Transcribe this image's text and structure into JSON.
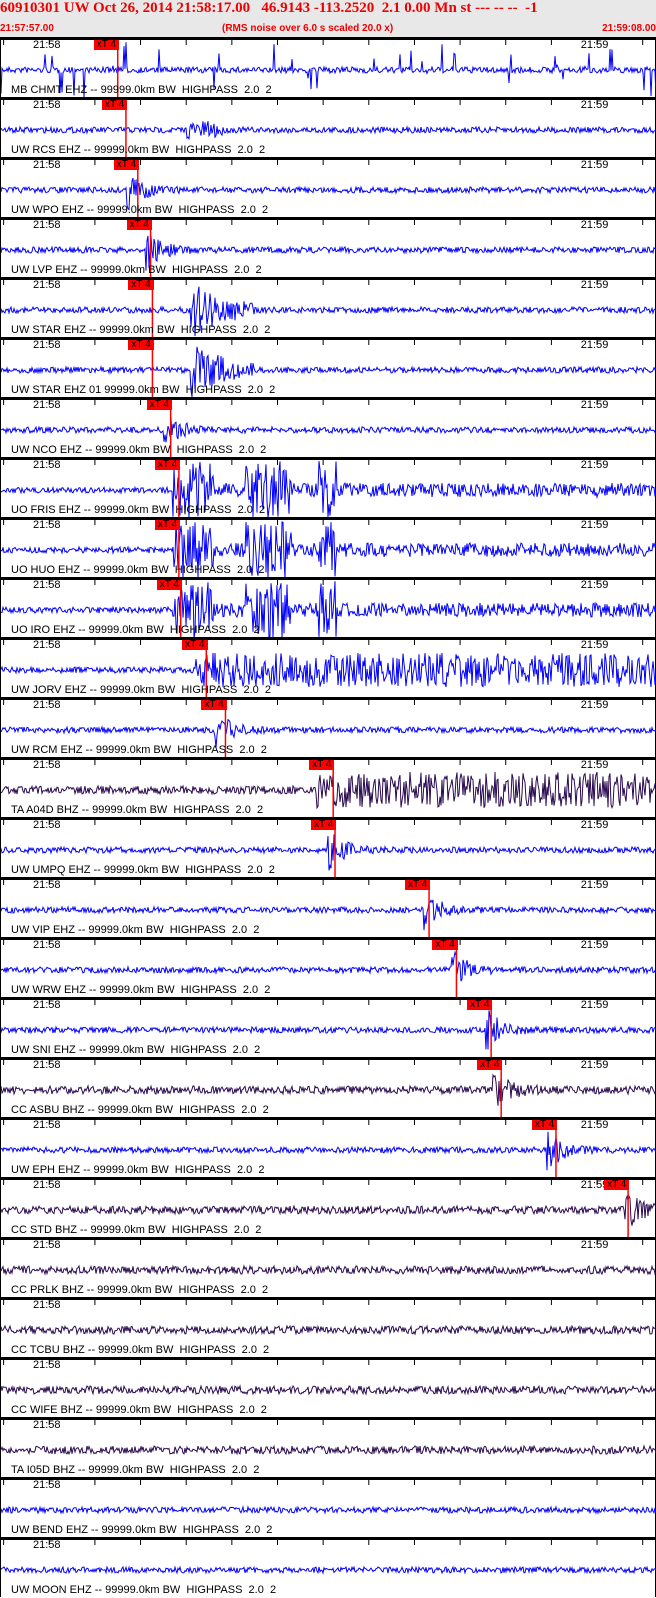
{
  "header": {
    "title": "60910301 UW Oct 26, 2014 21:58:17.00   46.9143 -113.2520  2.1 0.00 Mn st --- -- --  -1",
    "start_time": "21:57:57.00",
    "note": "(RMS noise over 6.0 s scaled 20.0 x)",
    "end_time": "21:59:08.00"
  },
  "chart_data": {
    "type": "line",
    "title": "60910301 UW Oct 26, 2014 21:58:17.00",
    "x_range_seconds": [
      0,
      71
    ],
    "x_start": "21:57:57.00",
    "x_end": "21:59:08.00",
    "tick_labels": [
      "21:58",
      "21:59"
    ],
    "tick_seconds": [
      3,
      63
    ],
    "pick_label": "xT 4",
    "traces": [
      {
        "label": "MB CHMT EHZ -- 99999.0km BW  HIGHPASS  2.0  2",
        "color": "#0000ff",
        "pick_s": 12.5,
        "onset_s": 12,
        "style": "spikes"
      },
      {
        "label": "UW RCS EHZ -- 99999.0km BW  HIGHPASS  2.0  2",
        "color": "#0000ff",
        "pick_s": 13.4,
        "onset_s": 13,
        "style": "noise"
      },
      {
        "label": "UW WPO EHZ -- 99999.0km BW  HIGHPASS  2.0  2",
        "color": "#0000ff",
        "pick_s": 14.7,
        "onset_s": 13.5,
        "style": "event"
      },
      {
        "label": "UW LVP EHZ -- 99999.0km BW  HIGHPASS  2.0  2",
        "color": "#0000ff",
        "pick_s": 16.1,
        "onset_s": 15.5,
        "style": "event"
      },
      {
        "label": "UW STAR EHZ -- 99999.0km BW  HIGHPASS  2.0  2",
        "color": "#0000ff",
        "pick_s": 16.3,
        "onset_s": 20.5,
        "style": "burst"
      },
      {
        "label": "UW STAR EHZ 01 99999.0km BW  HIGHPASS  2.0  2",
        "color": "#0000ff",
        "pick_s": 16.3,
        "onset_s": 20.5,
        "style": "burst"
      },
      {
        "label": "UW NCO EHZ -- 99999.0km BW  HIGHPASS  2.0  2",
        "color": "#0000ff",
        "pick_s": 18.3,
        "onset_s": 17.5,
        "style": "event"
      },
      {
        "label": "UO FRIS EHZ -- 99999.0km BW  HIGHPASS  2.0  2",
        "color": "#0000ff",
        "pick_s": 19.2,
        "onset_s": 18.5,
        "style": "burst2"
      },
      {
        "label": "UO HUO EHZ -- 99999.0km BW  HIGHPASS  2.0  2",
        "color": "#0000ff",
        "pick_s": 19.2,
        "onset_s": 18.5,
        "style": "burst2"
      },
      {
        "label": "UO IRO EHZ -- 99999.0km BW  HIGHPASS  2.0  2",
        "color": "#0000ff",
        "pick_s": 19.4,
        "onset_s": 18.5,
        "style": "burst2"
      },
      {
        "label": "UW JORV EHZ -- 99999.0km BW  HIGHPASS  2.0  2",
        "color": "#0000ff",
        "pick_s": 22.2,
        "onset_s": 21,
        "style": "long"
      },
      {
        "label": "UW RCM EHZ -- 99999.0km BW  HIGHPASS  2.0  2",
        "color": "#0000ff",
        "pick_s": 24.3,
        "onset_s": 23,
        "style": "event"
      },
      {
        "label": "TA A04D BHZ -- 99999.0km BW  HIGHPASS  2.0  2",
        "color": "#2a0a50",
        "pick_s": 36.1,
        "onset_s": 34,
        "style": "long"
      },
      {
        "label": "UW UMPQ EHZ -- 99999.0km BW  HIGHPASS  2.0  2",
        "color": "#0000ff",
        "pick_s": 36.3,
        "onset_s": 35.5,
        "style": "event"
      },
      {
        "label": "UW VIP EHZ -- 99999.0km BW  HIGHPASS  2.0  2",
        "color": "#0000ff",
        "pick_s": 46.6,
        "onset_s": 46,
        "style": "event"
      },
      {
        "label": "UW WRW EHZ -- 99999.0km BW  HIGHPASS  2.0  2",
        "color": "#0000ff",
        "pick_s": 49.6,
        "onset_s": 49,
        "style": "event"
      },
      {
        "label": "UW SNI EHZ -- 99999.0km BW  HIGHPASS  2.0  2",
        "color": "#0000ff",
        "pick_s": 53.4,
        "onset_s": 52.8,
        "style": "event"
      },
      {
        "label": "CC ASBU BHZ -- 99999.0km BW  HIGHPASS  2.0  2",
        "color": "#2a0a50",
        "pick_s": 54.5,
        "onset_s": 53.5,
        "style": "event"
      },
      {
        "label": "UW EPH EHZ -- 99999.0km BW  HIGHPASS  2.0  2",
        "color": "#0000ff",
        "pick_s": 60.5,
        "onset_s": 59.5,
        "style": "event"
      },
      {
        "label": "CC STD BHZ -- 99999.0km BW  HIGHPASS  2.0  2",
        "color": "#2a0a50",
        "pick_s": 68.4,
        "onset_s": 68,
        "style": "event"
      },
      {
        "label": "CC PRLK BHZ -- 99999.0km BW  HIGHPASS  2.0  2",
        "color": "#2a0a50",
        "pick_s": null,
        "onset_s": null,
        "style": "noise"
      },
      {
        "label": "CC TCBU BHZ -- 99999.0km BW  HIGHPASS  2.0  2",
        "color": "#2a0a50",
        "pick_s": null,
        "onset_s": null,
        "style": "noise"
      },
      {
        "label": "CC WIFE BHZ -- 99999.0km BW  HIGHPASS  2.0  2",
        "color": "#2a0a50",
        "pick_s": null,
        "onset_s": null,
        "style": "noise"
      },
      {
        "label": "TA I05D BHZ -- 99999.0km BW  HIGHPASS  2.0  2",
        "color": "#2a0a50",
        "pick_s": null,
        "onset_s": null,
        "style": "noise"
      },
      {
        "label": "UW BEND EHZ -- 99999.0km BW  HIGHPASS  2.0  2",
        "color": "#0000ff",
        "pick_s": null,
        "onset_s": null,
        "style": "noise"
      },
      {
        "label": "UW MOON EHZ -- 99999.0km BW  HIGHPASS  2.0  2",
        "color": "#0000ff",
        "pick_s": null,
        "onset_s": null,
        "style": "noise"
      }
    ]
  }
}
